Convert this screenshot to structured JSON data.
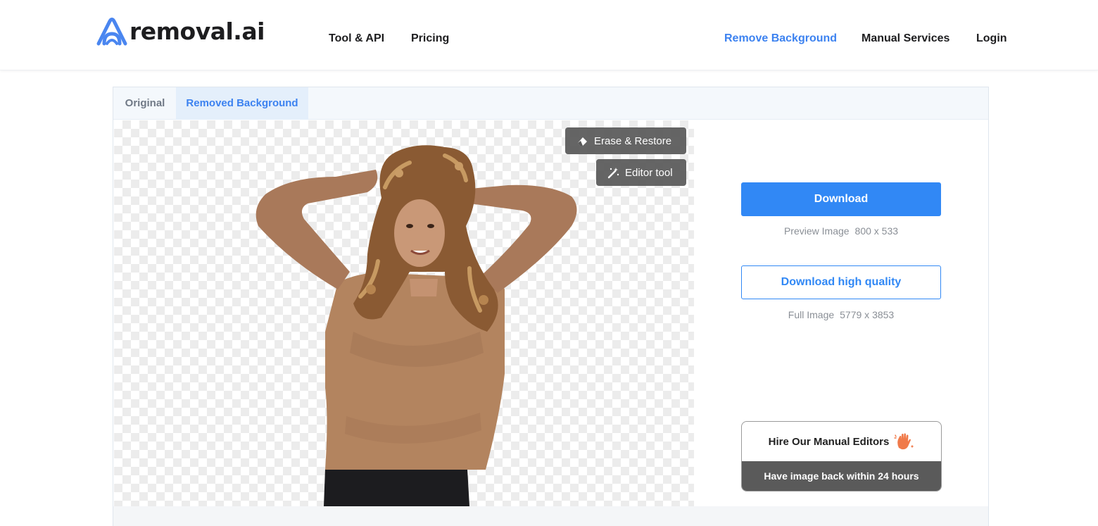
{
  "header": {
    "logo_text": "removal.ai",
    "nav_left": [
      {
        "label": "Tool & API"
      },
      {
        "label": "Pricing"
      }
    ],
    "nav_right": [
      {
        "label": "Remove Background",
        "active": true
      },
      {
        "label": "Manual Services"
      },
      {
        "label": "Login"
      }
    ]
  },
  "tabs": [
    {
      "label": "Original",
      "active": false
    },
    {
      "label": "Removed Background",
      "active": true
    }
  ],
  "canvas_tools": {
    "erase_restore": {
      "label": "Erase & Restore",
      "icon": "eraser-icon"
    },
    "editor_tool": {
      "label": "Editor tool",
      "icon": "magic-wand-icon"
    }
  },
  "actions": {
    "download_label": "Download",
    "preview_label": "Preview Image",
    "preview_size": "800 x 533",
    "download_hq_label": "Download high quality",
    "full_label": "Full Image",
    "full_size": "5779 x 3853"
  },
  "hire": {
    "title": "Hire Our Manual Editors",
    "icon": "waving-hand-icon",
    "subtitle": "Have image back within 24 hours"
  },
  "colors": {
    "accent": "#3188f5",
    "nav_accent": "#3c82f0",
    "dark_button": "#5a5a5a"
  }
}
